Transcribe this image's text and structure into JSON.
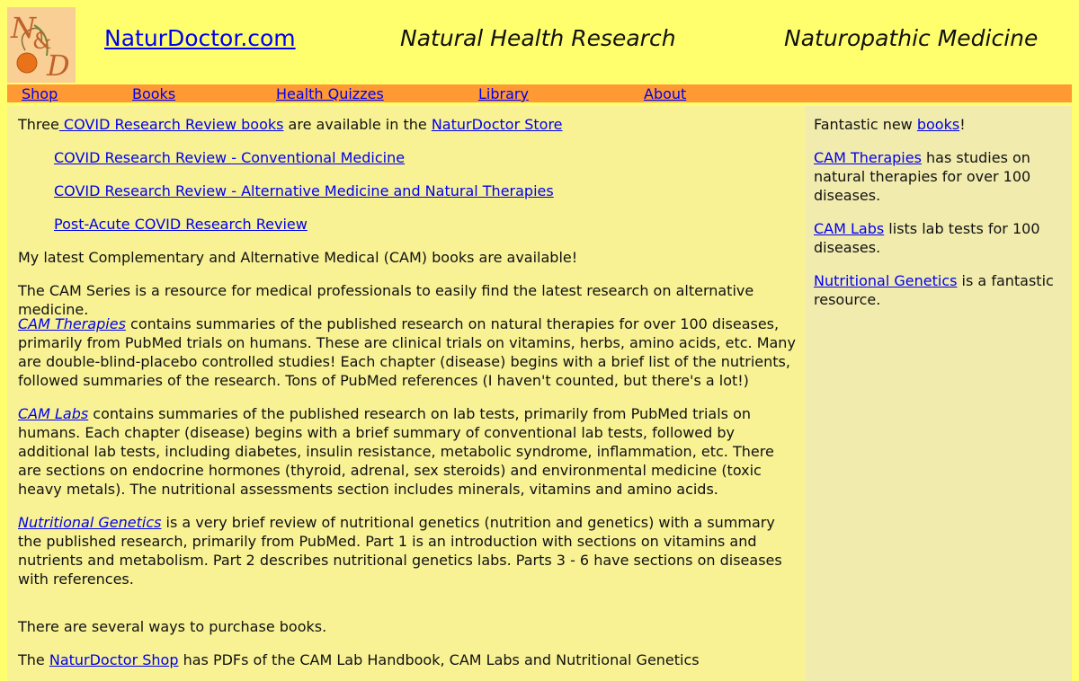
{
  "header": {
    "site_link": "NaturDoctor.com",
    "tagline_1": "Natural Health Research",
    "tagline_2": "Naturopathic Medicine",
    "logo_letters": "N&D"
  },
  "nav": {
    "items": [
      {
        "label": "Shop"
      },
      {
        "label": "Books"
      },
      {
        "label": "Health Quizzes"
      },
      {
        "label": "Library"
      },
      {
        "label": "About"
      }
    ]
  },
  "main": {
    "intro": {
      "prefix": "Three",
      "link_books": " COVID Research Review books",
      "middle": " are available in the ",
      "link_store": "NaturDoctor Store"
    },
    "covid_links": [
      "COVID Research Review - Conventional Medicine",
      "COVID Research Review - Alternative Medicine and Natural Therapies",
      "Post-Acute COVID Research Review"
    ],
    "latest_books": "My latest Complementary and Alternative Medical (CAM) books are available!",
    "cam_series": "The CAM Series is a resource for medical professionals to easily find the latest research on alternative medicine.",
    "cam_therapies": {
      "title": "CAM Therapies",
      "text": " contains summaries of the published research on natural therapies for over 100 diseases, primarily from PubMed trials on humans. These are clinical trials on vitamins, herbs, amino acids, etc. Many are double-blind-placebo controlled studies! Each chapter (disease) begins with a brief list of the nutrients, followed summaries of the research. Tons of PubMed references (I haven't counted, but there's a lot!)"
    },
    "cam_labs": {
      "title": "CAM Labs",
      "text": " contains summaries of the published research on lab tests, primarily from PubMed trials on humans. Each chapter (disease) begins with a brief summary of conventional lab tests, followed by additional lab tests, including diabetes, insulin resistance, metabolic syndrome, inflammation, etc. There are sections on endocrine hormones (thyroid, adrenal, sex steroids) and environmental medicine (toxic heavy metals). The nutritional assessments section includes minerals, vitamins and amino acids."
    },
    "nutritional_genetics": {
      "title": "Nutritional Genetics",
      "text": " is a very brief review of nutritional genetics (nutrition and genetics) with a summary the published research, primarily from PubMed. Part 1 is an introduction with sections on vitamins and nutrients and metabolism. Part 2 describes nutritional genetics labs. Parts 3 - 6 have sections on diseases with references."
    },
    "purchase": "There are several ways to purchase books.",
    "shop_line": {
      "prefix": "The ",
      "link": "NaturDoctor Shop",
      "text": " has PDFs of the CAM Lab Handbook, CAM Labs and Nutritional Genetics"
    }
  },
  "sidebar": {
    "fantastic": {
      "prefix": "Fantastic new ",
      "link": "books",
      "suffix": "!"
    },
    "cam_therapies": {
      "link": "CAM Therapies",
      "text": " has studies on natural therapies for over 100 diseases."
    },
    "cam_labs": {
      "link": "CAM Labs",
      "text": " lists lab tests for 100 diseases."
    },
    "nutritional_genetics": {
      "link": "Nutritional Genetics",
      "text": " is a fantastic resource."
    }
  },
  "colors": {
    "page_bg": "#ffff6e",
    "nav_bg": "#ff9933",
    "main_bg": "#f8f295",
    "sidebar_bg": "#f2ebae",
    "link": "#0000ee"
  }
}
